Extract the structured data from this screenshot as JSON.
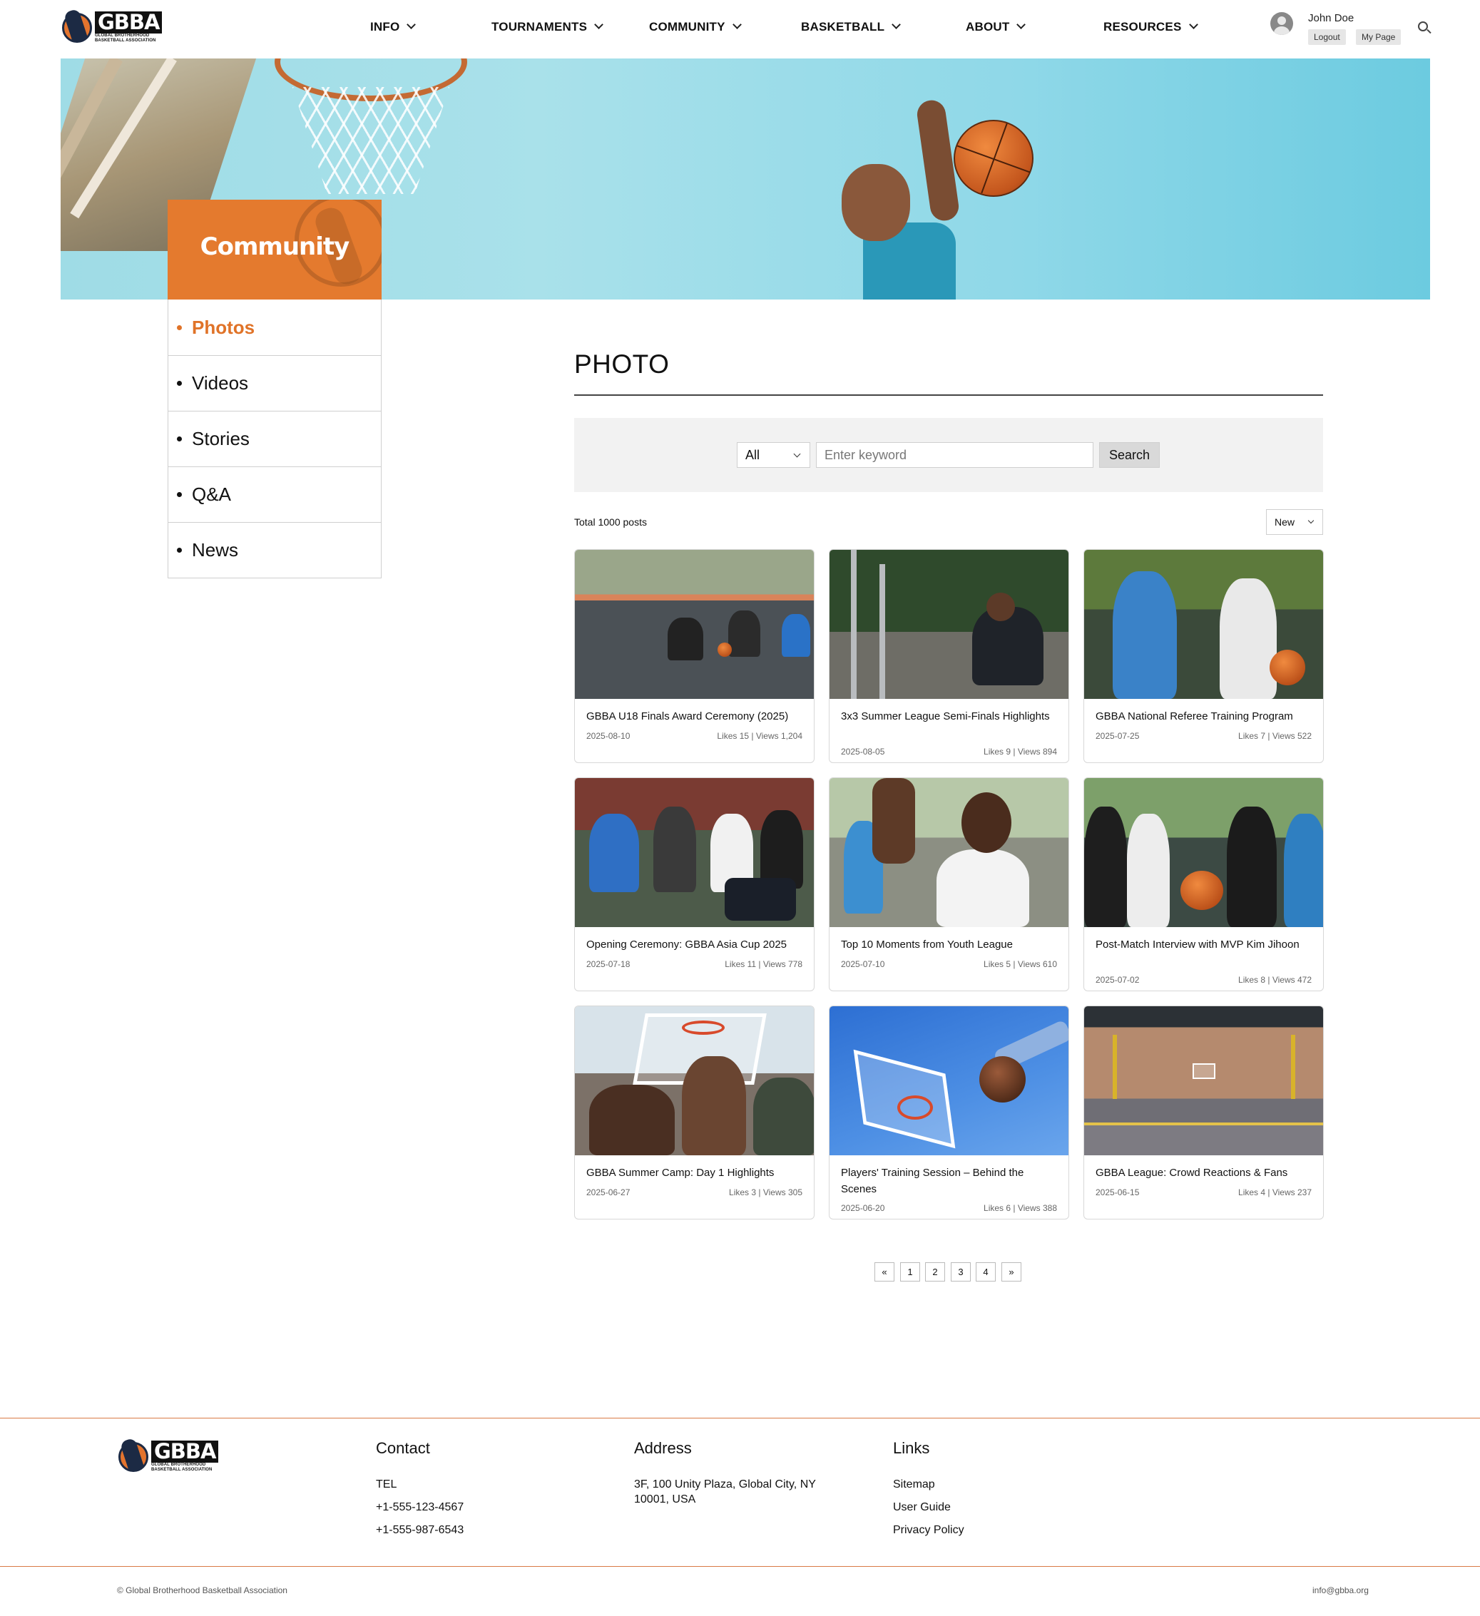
{
  "header": {
    "logo_text": "GBBA",
    "logo_subtext_1": "GLOBAL BROTHERHOOD",
    "logo_subtext_2": "BASKETBALL ASSOCIATION",
    "nav": [
      "INFO",
      "TOURNAMENTS",
      "COMMUNITY",
      "BASKETBALL",
      "ABOUT",
      "RESOURCES"
    ],
    "user_name": "John Doe",
    "logout_label": "Logout",
    "mypage_label": "My Page"
  },
  "hero": {
    "section_title": "Community"
  },
  "sidebar": {
    "items": [
      "Photos",
      "Videos",
      "Stories",
      "Q&A",
      "News"
    ],
    "active_index": 0
  },
  "main": {
    "title": "PHOTO",
    "search": {
      "category_value": "All",
      "keyword_placeholder": "Enter keyword",
      "search_label": "Search"
    },
    "total_posts": "Total 1000 posts",
    "sort_value": "New",
    "cards": [
      {
        "title": "GBBA U18 Finals Award Ceremony (2025)",
        "date": "2025-08-10",
        "stats": "Likes 15 | Views 1,204"
      },
      {
        "title": "3x3 Summer League Semi-Finals Highlights",
        "date": "2025-08-05",
        "stats": "Likes 9 | Views 894"
      },
      {
        "title": "GBBA National Referee Training Program",
        "date": "2025-07-25",
        "stats": "Likes 7 | Views 522"
      },
      {
        "title": "Opening Ceremony: GBBA Asia Cup 2025",
        "date": "2025-07-18",
        "stats": "Likes 11 | Views 778"
      },
      {
        "title": "Top 10 Moments from Youth League",
        "date": "2025-07-10",
        "stats": "Likes 5 | Views 610"
      },
      {
        "title": "Post-Match Interview with MVP Kim Jihoon",
        "date": "2025-07-02",
        "stats": "Likes 8 | Views 472"
      },
      {
        "title": "GBBA Summer Camp: Day 1 Highlights",
        "date": "2025-06-27",
        "stats": "Likes 3 | Views 305"
      },
      {
        "title": "Players' Training Session – Behind the Scenes",
        "date": "2025-06-20",
        "stats": "Likes 6 | Views 388"
      },
      {
        "title": "GBBA League: Crowd Reactions & Fans",
        "date": "2025-06-15",
        "stats": "Likes 4 | Views 237"
      }
    ],
    "pagination": [
      "«",
      "1",
      "2",
      "3",
      "4",
      "»"
    ]
  },
  "footer": {
    "contact_title": "Contact",
    "tel_label": "TEL",
    "phones": [
      "+1-555-123-4567",
      "+1-555-987-6543"
    ],
    "address_title": "Address",
    "address_line1": "3F, 100 Unity Plaza, Global City, NY",
    "address_line2": "10001, USA",
    "links_title": "Links",
    "links": [
      "Sitemap",
      "User Guide",
      "Privacy Policy"
    ],
    "copyright": "© Global Brotherhood Basketball Association",
    "email": "info@gbba.org"
  },
  "colors": {
    "accent": "#e47a2e",
    "footer_rule": "#d97a45"
  }
}
